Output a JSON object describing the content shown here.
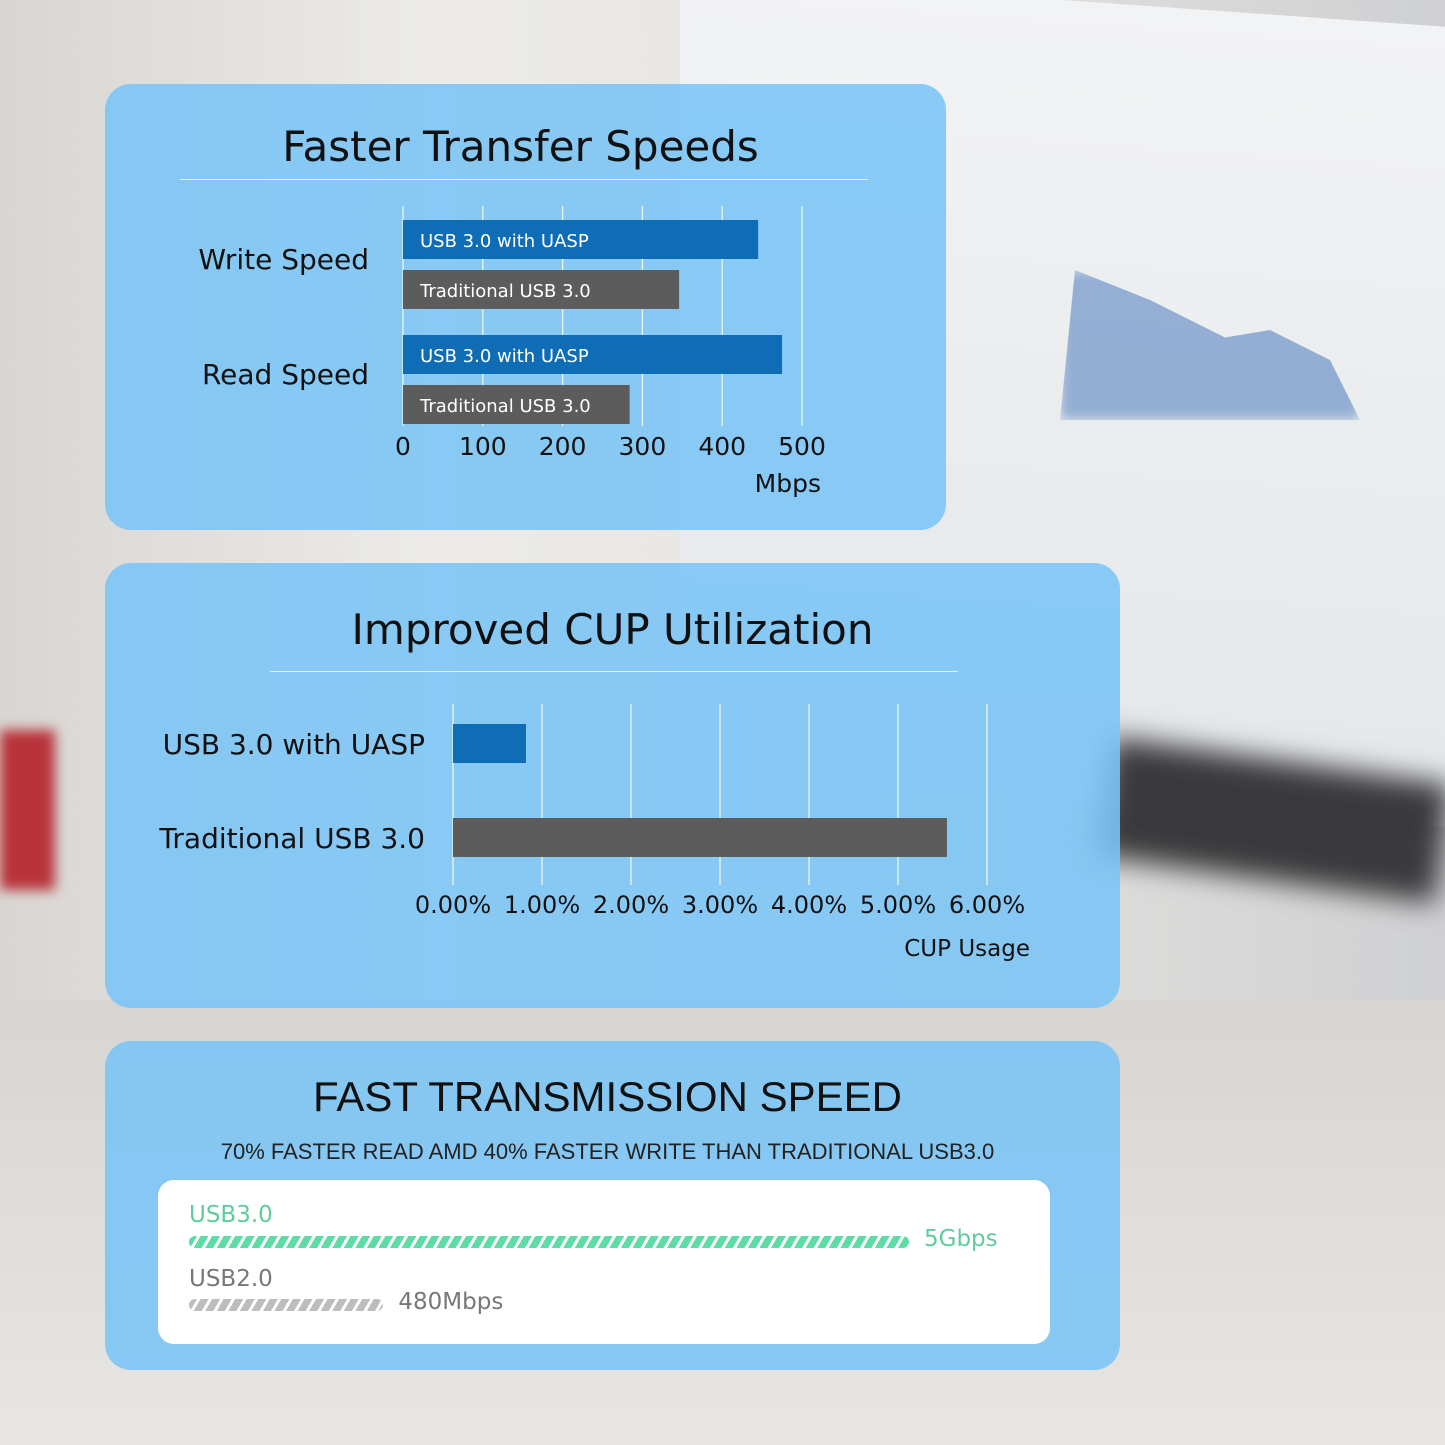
{
  "chart_data": [
    {
      "type": "bar",
      "orientation": "horizontal",
      "title": "Faster Transfer Speeds",
      "categories": [
        "Write Speed",
        "Read Speed"
      ],
      "series": [
        {
          "name": "USB 3.0 with UASP",
          "values": [
            445,
            475
          ],
          "color": "#0e6db5"
        },
        {
          "name": "Traditional USB 3.0",
          "values": [
            346,
            284
          ],
          "color": "#5c5c5c"
        }
      ],
      "xticks": [
        "0",
        "100",
        "200",
        "300",
        "400",
        "500"
      ],
      "xlim": [
        0,
        500
      ],
      "xlabel": "Mbps",
      "grid": true
    },
    {
      "type": "bar",
      "orientation": "horizontal",
      "title": "Improved CUP Utilization",
      "categories": [
        "USB 3.0 with UASP",
        "Traditional USB 3.0"
      ],
      "values": [
        0.82,
        5.55
      ],
      "colors": [
        "#0e6db5",
        "#5c5c5c"
      ],
      "xticks": [
        "0.00%",
        "1.00%",
        "2.00%",
        "3.00%",
        "4.00%",
        "5.00%",
        "6.00%"
      ],
      "xlim": [
        0,
        6
      ],
      "xlabel": "CUP Usage",
      "grid": true
    }
  ],
  "transmission": {
    "title": "FAST TRANSMISSION SPEED",
    "subtitle": "70% FASTER READ AMD 40% FASTER WRITE THAN TRADITIONAL USB3.0",
    "items": [
      {
        "label": "USB3.0",
        "value": "5Gbps",
        "fraction": 1.0,
        "color": "#5fdba6"
      },
      {
        "label": "USB2.0",
        "value": "480Mbps",
        "fraction": 0.27,
        "color": "#bdbdbd"
      }
    ]
  }
}
